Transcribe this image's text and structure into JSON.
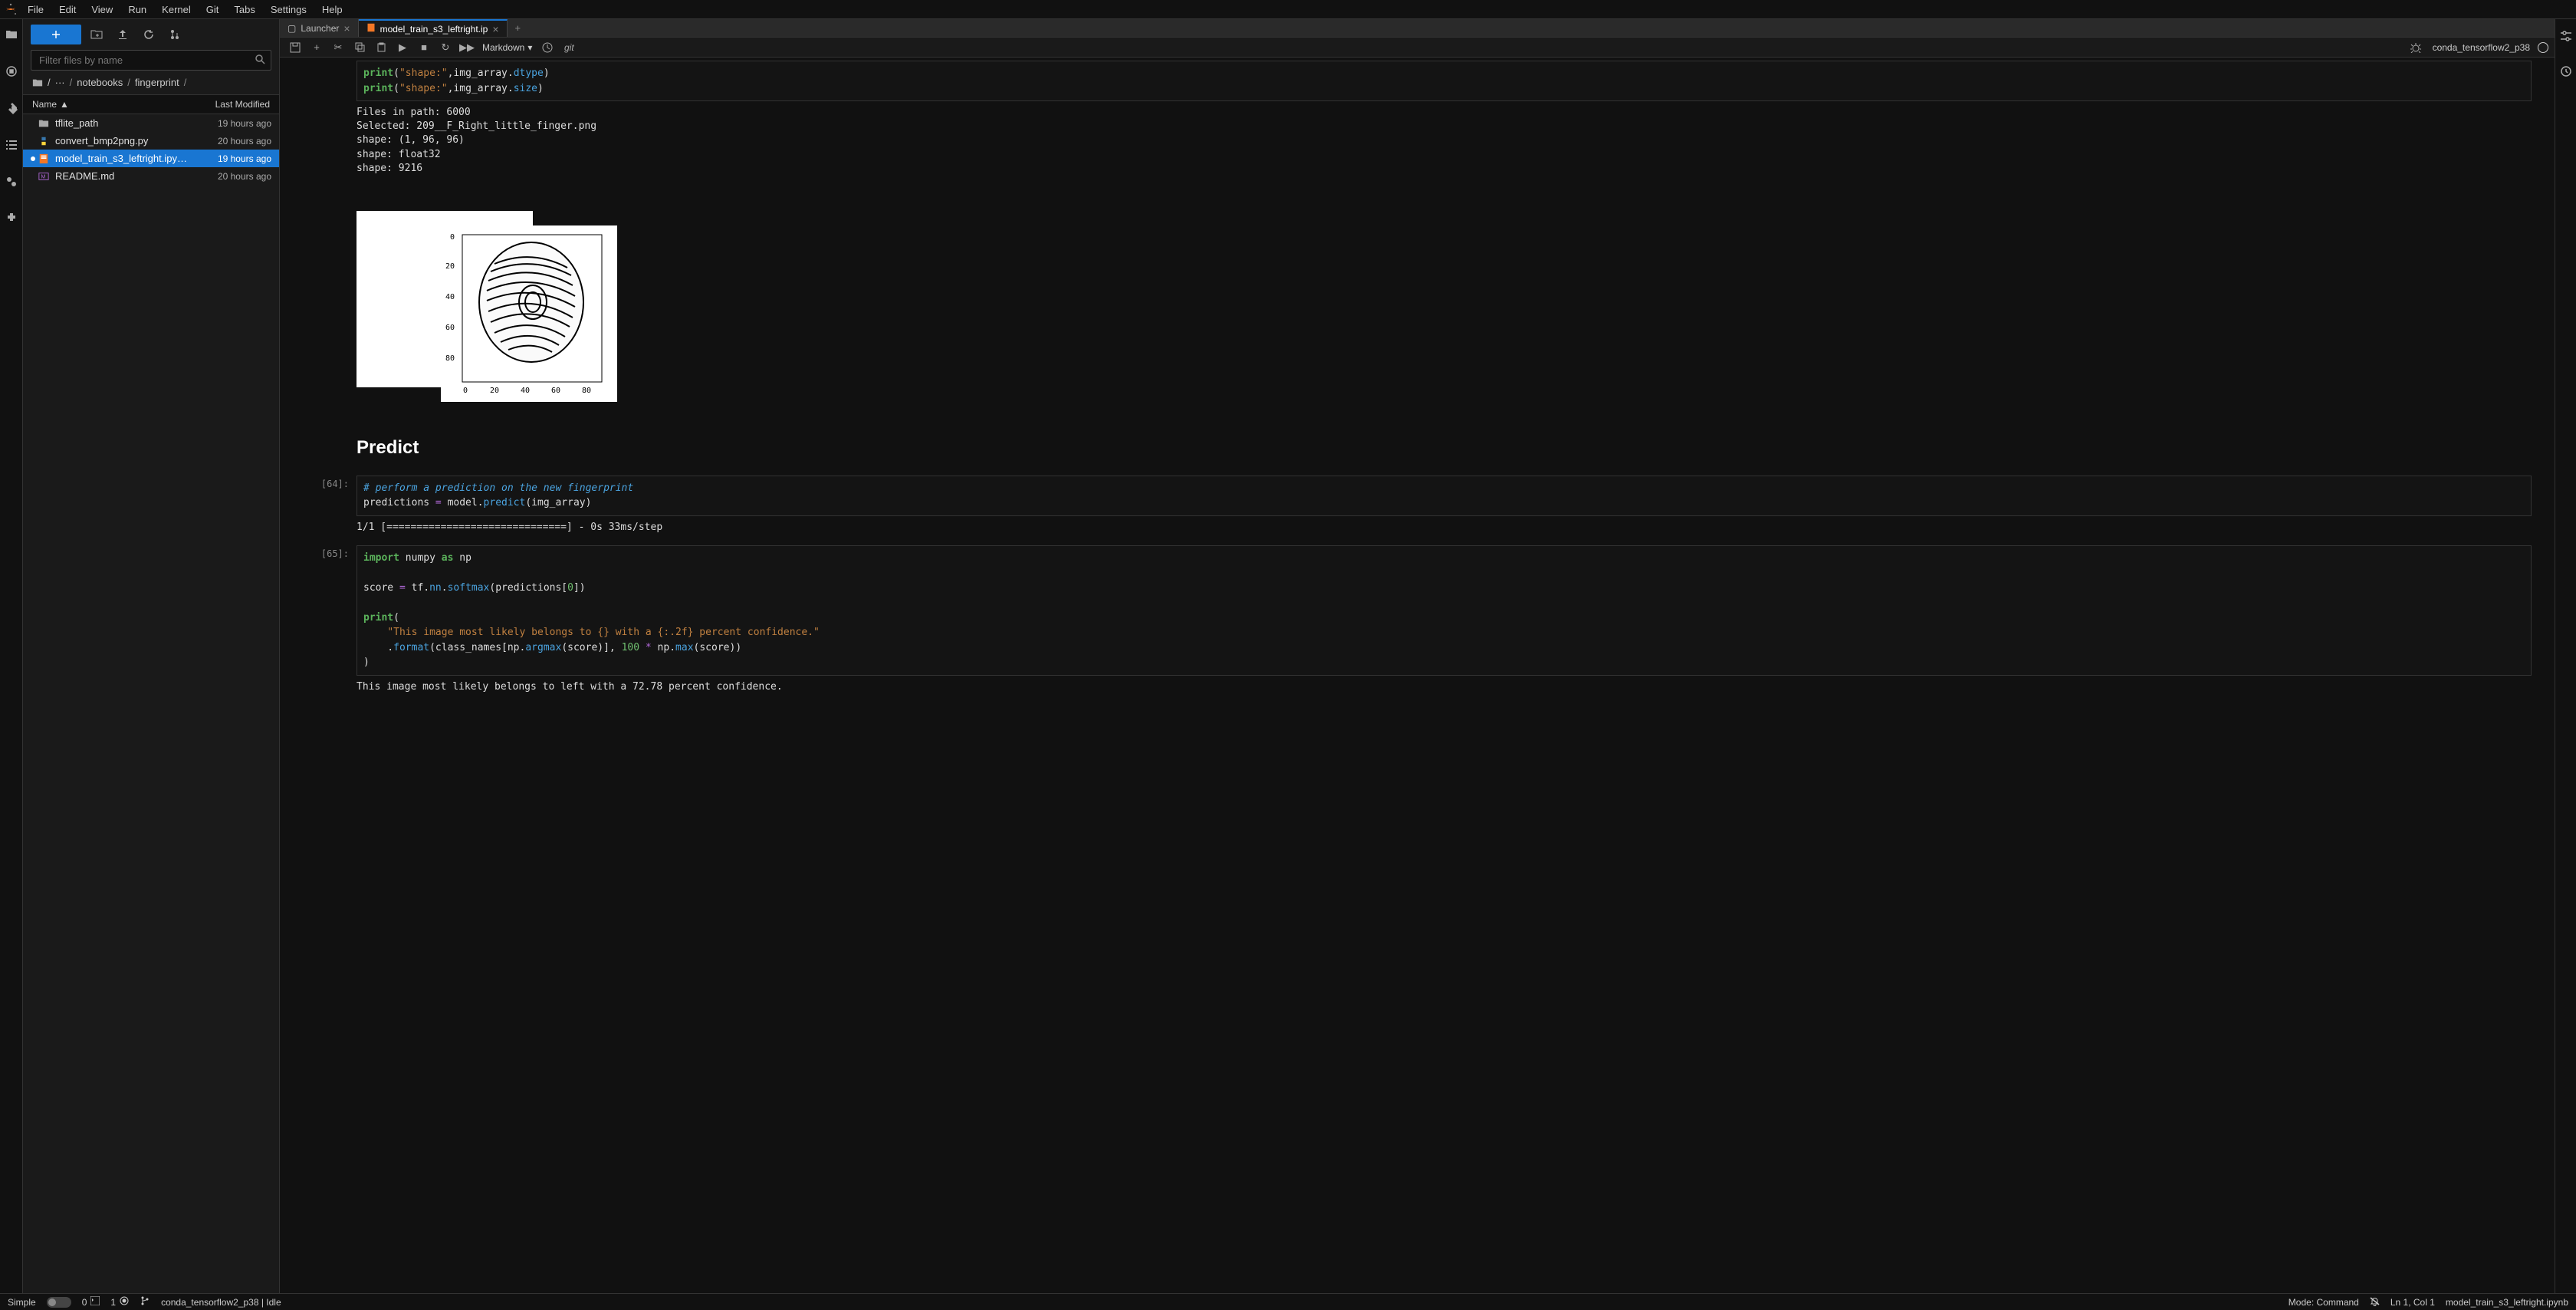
{
  "menubar": {
    "items": [
      "File",
      "Edit",
      "View",
      "Run",
      "Kernel",
      "Git",
      "Tabs",
      "Settings",
      "Help"
    ]
  },
  "sidebar": {
    "new_btn": "+",
    "filter_placeholder": "Filter files by name",
    "breadcrumb": [
      "/",
      "···",
      "/",
      "notebooks",
      "/",
      "fingerprint",
      "/"
    ],
    "header_name": "Name",
    "header_modified": "Last Modified",
    "files": [
      {
        "icon": "folder",
        "name": "tflite_path",
        "time": "19 hours ago",
        "dirty": false,
        "selected": false
      },
      {
        "icon": "python",
        "name": "convert_bmp2png.py",
        "time": "20 hours ago",
        "dirty": false,
        "selected": false
      },
      {
        "icon": "notebook",
        "name": "model_train_s3_leftright.ipy…",
        "time": "19 hours ago",
        "dirty": true,
        "selected": true
      },
      {
        "icon": "markdown",
        "name": "README.md",
        "time": "20 hours ago",
        "dirty": false,
        "selected": false
      }
    ]
  },
  "tabs": [
    {
      "label": "Launcher",
      "icon": "launcher",
      "active": false,
      "closable": true
    },
    {
      "label": "model_train_s3_leftright.ip",
      "icon": "notebook",
      "active": true,
      "closable": true
    }
  ],
  "notebook_toolbar": {
    "celltype": "Markdown",
    "git": "git",
    "kernel": "conda_tensorflow2_p38"
  },
  "cells": {
    "code_top": "print(\"shape:\",img_array.dtype)\nprint(\"shape:\",img_array.size)",
    "out_top": "Files in path: 6000\nSelected: 209__F_Right_little_finger.png\nshape: (1, 96, 96)\nshape: float32\nshape: 9216",
    "md_heading": "Predict",
    "prompt64": "[64]:",
    "code64_comment": "# perform a prediction on the new fingerprint",
    "code64_line": "predictions = model.predict(img_array)",
    "out64": "1/1 [==============================] - 0s 33ms/step",
    "prompt65": "[65]:",
    "code65": "import numpy as np\n\nscore = tf.nn.softmax(predictions[0])\n\nprint(\n    \"This image most likely belongs to {} with a {:.2f} percent confidence.\"\n    .format(class_names[np.argmax(score)], 100 * np.max(score))\n)",
    "out65": "This image most likely belongs to left with a 72.78 percent confidence."
  },
  "statusbar": {
    "simple": "Simple",
    "zero": "0",
    "one": "1",
    "kernel_status": "conda_tensorflow2_p38 | Idle",
    "mode": "Mode: Command",
    "ln_col": "Ln 1, Col 1",
    "filename": "model_train_s3_leftright.ipynb"
  }
}
